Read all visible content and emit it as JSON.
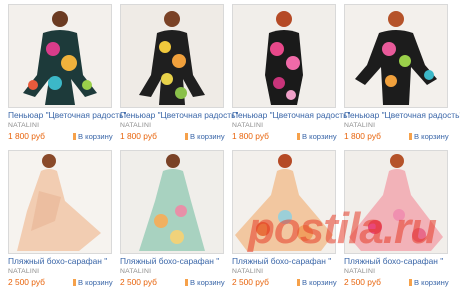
{
  "products": [
    {
      "title": "Пеньюар \"Цветочная радость\"",
      "brand": "NATALINI",
      "price": "1 800 руб",
      "cart": "В корзину"
    },
    {
      "title": "Пеньюар \"Цветочная радость\"",
      "brand": "NATALINI",
      "price": "1 800 руб",
      "cart": "В корзину"
    },
    {
      "title": "Пеньюар \"Цветочная радость\"",
      "brand": "NATALINI",
      "price": "1 800 руб",
      "cart": "В корзину"
    },
    {
      "title": "Пеньюар \"Цветочная радость\"",
      "brand": "NATALINI",
      "price": "1 800 руб",
      "cart": "В корзину"
    },
    {
      "title": "Пляжный бохо-сарафан \"",
      "brand": "NATALINI",
      "price": "2 500 руб",
      "cart": "В корзину"
    },
    {
      "title": "Пляжный бохо-сарафан \"",
      "brand": "NATALINI",
      "price": "2 500 руб",
      "cart": "В корзину"
    },
    {
      "title": "Пляжный бохо-сарафан \"",
      "brand": "NATALINI",
      "price": "2 500 руб",
      "cart": "В корзину"
    },
    {
      "title": "Пляжный бохо-сарафан \"",
      "brand": "NATALINI",
      "price": "2 500 руб",
      "cart": "В корзину"
    }
  ],
  "watermark": "postila.ru",
  "colors": {
    "link": "#3a66a8",
    "price": "#e8640c",
    "watermark": "#e63c28"
  }
}
